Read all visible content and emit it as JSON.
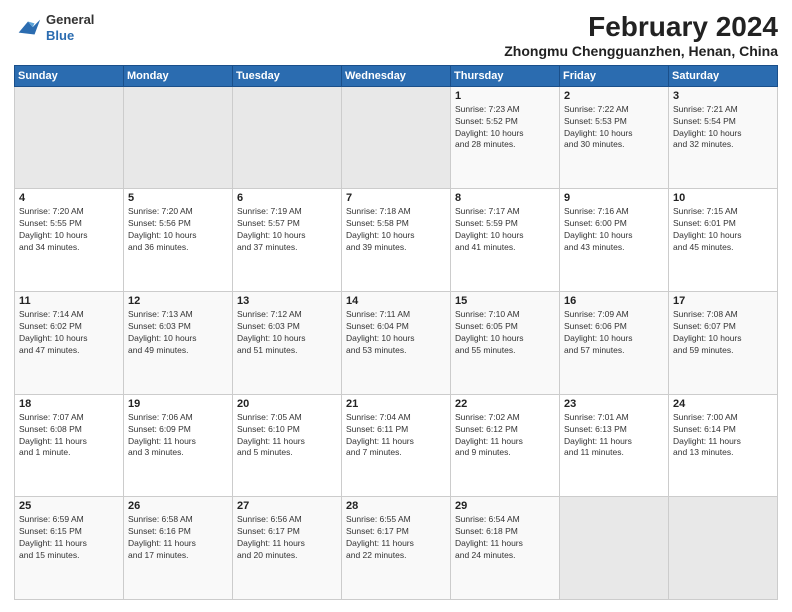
{
  "header": {
    "logo_line1": "General",
    "logo_line2": "Blue",
    "month": "February 2024",
    "location": "Zhongmu Chengguanzhen, Henan, China"
  },
  "days_of_week": [
    "Sunday",
    "Monday",
    "Tuesday",
    "Wednesday",
    "Thursday",
    "Friday",
    "Saturday"
  ],
  "weeks": [
    [
      {
        "num": "",
        "info": "",
        "empty": true
      },
      {
        "num": "",
        "info": "",
        "empty": true
      },
      {
        "num": "",
        "info": "",
        "empty": true
      },
      {
        "num": "",
        "info": "",
        "empty": true
      },
      {
        "num": "1",
        "info": "Sunrise: 7:23 AM\nSunset: 5:52 PM\nDaylight: 10 hours\nand 28 minutes."
      },
      {
        "num": "2",
        "info": "Sunrise: 7:22 AM\nSunset: 5:53 PM\nDaylight: 10 hours\nand 30 minutes."
      },
      {
        "num": "3",
        "info": "Sunrise: 7:21 AM\nSunset: 5:54 PM\nDaylight: 10 hours\nand 32 minutes."
      }
    ],
    [
      {
        "num": "4",
        "info": "Sunrise: 7:20 AM\nSunset: 5:55 PM\nDaylight: 10 hours\nand 34 minutes."
      },
      {
        "num": "5",
        "info": "Sunrise: 7:20 AM\nSunset: 5:56 PM\nDaylight: 10 hours\nand 36 minutes."
      },
      {
        "num": "6",
        "info": "Sunrise: 7:19 AM\nSunset: 5:57 PM\nDaylight: 10 hours\nand 37 minutes."
      },
      {
        "num": "7",
        "info": "Sunrise: 7:18 AM\nSunset: 5:58 PM\nDaylight: 10 hours\nand 39 minutes."
      },
      {
        "num": "8",
        "info": "Sunrise: 7:17 AM\nSunset: 5:59 PM\nDaylight: 10 hours\nand 41 minutes."
      },
      {
        "num": "9",
        "info": "Sunrise: 7:16 AM\nSunset: 6:00 PM\nDaylight: 10 hours\nand 43 minutes."
      },
      {
        "num": "10",
        "info": "Sunrise: 7:15 AM\nSunset: 6:01 PM\nDaylight: 10 hours\nand 45 minutes."
      }
    ],
    [
      {
        "num": "11",
        "info": "Sunrise: 7:14 AM\nSunset: 6:02 PM\nDaylight: 10 hours\nand 47 minutes."
      },
      {
        "num": "12",
        "info": "Sunrise: 7:13 AM\nSunset: 6:03 PM\nDaylight: 10 hours\nand 49 minutes."
      },
      {
        "num": "13",
        "info": "Sunrise: 7:12 AM\nSunset: 6:03 PM\nDaylight: 10 hours\nand 51 minutes."
      },
      {
        "num": "14",
        "info": "Sunrise: 7:11 AM\nSunset: 6:04 PM\nDaylight: 10 hours\nand 53 minutes."
      },
      {
        "num": "15",
        "info": "Sunrise: 7:10 AM\nSunset: 6:05 PM\nDaylight: 10 hours\nand 55 minutes."
      },
      {
        "num": "16",
        "info": "Sunrise: 7:09 AM\nSunset: 6:06 PM\nDaylight: 10 hours\nand 57 minutes."
      },
      {
        "num": "17",
        "info": "Sunrise: 7:08 AM\nSunset: 6:07 PM\nDaylight: 10 hours\nand 59 minutes."
      }
    ],
    [
      {
        "num": "18",
        "info": "Sunrise: 7:07 AM\nSunset: 6:08 PM\nDaylight: 11 hours\nand 1 minute."
      },
      {
        "num": "19",
        "info": "Sunrise: 7:06 AM\nSunset: 6:09 PM\nDaylight: 11 hours\nand 3 minutes."
      },
      {
        "num": "20",
        "info": "Sunrise: 7:05 AM\nSunset: 6:10 PM\nDaylight: 11 hours\nand 5 minutes."
      },
      {
        "num": "21",
        "info": "Sunrise: 7:04 AM\nSunset: 6:11 PM\nDaylight: 11 hours\nand 7 minutes."
      },
      {
        "num": "22",
        "info": "Sunrise: 7:02 AM\nSunset: 6:12 PM\nDaylight: 11 hours\nand 9 minutes."
      },
      {
        "num": "23",
        "info": "Sunrise: 7:01 AM\nSunset: 6:13 PM\nDaylight: 11 hours\nand 11 minutes."
      },
      {
        "num": "24",
        "info": "Sunrise: 7:00 AM\nSunset: 6:14 PM\nDaylight: 11 hours\nand 13 minutes."
      }
    ],
    [
      {
        "num": "25",
        "info": "Sunrise: 6:59 AM\nSunset: 6:15 PM\nDaylight: 11 hours\nand 15 minutes."
      },
      {
        "num": "26",
        "info": "Sunrise: 6:58 AM\nSunset: 6:16 PM\nDaylight: 11 hours\nand 17 minutes."
      },
      {
        "num": "27",
        "info": "Sunrise: 6:56 AM\nSunset: 6:17 PM\nDaylight: 11 hours\nand 20 minutes."
      },
      {
        "num": "28",
        "info": "Sunrise: 6:55 AM\nSunset: 6:17 PM\nDaylight: 11 hours\nand 22 minutes."
      },
      {
        "num": "29",
        "info": "Sunrise: 6:54 AM\nSunset: 6:18 PM\nDaylight: 11 hours\nand 24 minutes."
      },
      {
        "num": "",
        "info": "",
        "empty": true
      },
      {
        "num": "",
        "info": "",
        "empty": true
      }
    ]
  ]
}
